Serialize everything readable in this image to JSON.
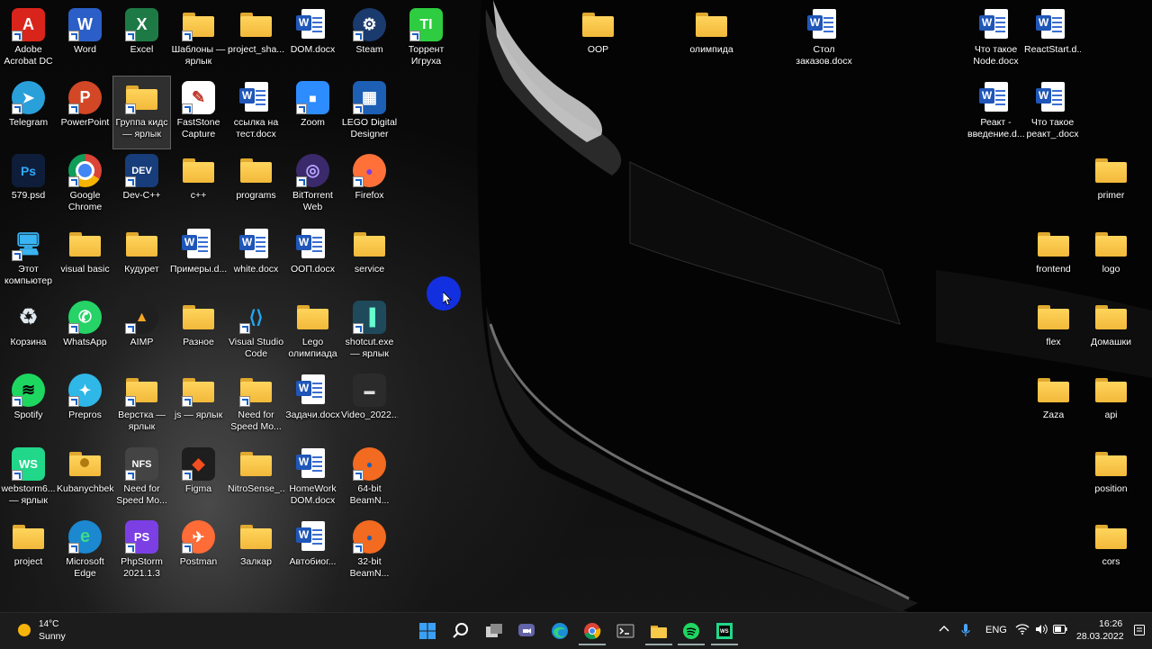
{
  "desktop": {
    "left_icons": [
      {
        "label": "Adobe Acrobat DC",
        "icon": "acrobat-icon"
      },
      {
        "label": "Word",
        "icon": "word-icon"
      },
      {
        "label": "Excel",
        "icon": "excel-icon"
      },
      {
        "label": "Шаблоны — ярлык",
        "icon": "folder-icon"
      },
      {
        "label": "project_sha...",
        "icon": "folder-icon"
      },
      {
        "label": "DOM.docx",
        "icon": "word-doc-icon"
      },
      {
        "label": "Steam",
        "icon": "steam-icon"
      },
      {
        "label": "Торрент Игруха",
        "icon": "torrent-igruha-icon"
      },
      {
        "label": "Telegram",
        "icon": "telegram-icon"
      },
      {
        "label": "PowerPoint",
        "icon": "powerpoint-icon"
      },
      {
        "label": "Группа кидс — ярлык",
        "icon": "folder-icon"
      },
      {
        "label": "FastStone Capture",
        "icon": "faststone-icon"
      },
      {
        "label": "ссылка на тест.docx",
        "icon": "word-doc-icon"
      },
      {
        "label": "Zoom",
        "icon": "zoom-icon"
      },
      {
        "label": "LEGO Digital Designer",
        "icon": "lego-icon"
      },
      {
        "label": "579.psd",
        "icon": "psd-icon"
      },
      {
        "label": "Google Chrome",
        "icon": "chrome-icon"
      },
      {
        "label": "Dev-C++",
        "icon": "devcpp-icon"
      },
      {
        "label": "c++",
        "icon": "folder-icon"
      },
      {
        "label": "programs",
        "icon": "folder-icon"
      },
      {
        "label": "BitTorrent Web",
        "icon": "bittorrent-icon"
      },
      {
        "label": "Firefox",
        "icon": "firefox-icon"
      },
      {
        "label": "Этот компьютер",
        "icon": "computer-icon"
      },
      {
        "label": "visual basic",
        "icon": "folder-icon"
      },
      {
        "label": "Кудурет",
        "icon": "folder-icon"
      },
      {
        "label": "Примеры.d...",
        "icon": "word-doc-icon"
      },
      {
        "label": "white.docx",
        "icon": "word-doc-icon"
      },
      {
        "label": "ООП.docx",
        "icon": "word-doc-icon"
      },
      {
        "label": "service",
        "icon": "folder-icon"
      },
      {
        "label": "Корзина",
        "icon": "recycle-bin-icon"
      },
      {
        "label": "WhatsApp",
        "icon": "whatsapp-icon"
      },
      {
        "label": "AIMP",
        "icon": "aimp-icon"
      },
      {
        "label": "Разное",
        "icon": "folder-icon"
      },
      {
        "label": "Visual Studio Code",
        "icon": "vscode-icon"
      },
      {
        "label": "Lego олимпиада",
        "icon": "folder-icon"
      },
      {
        "label": "shotcut.exe — ярлык",
        "icon": "shotcut-icon"
      },
      {
        "label": "Spotify",
        "icon": "spotify-icon"
      },
      {
        "label": "Prepros",
        "icon": "prepros-icon"
      },
      {
        "label": "Верстка — ярлык",
        "icon": "folder-icon"
      },
      {
        "label": "js — ярлык",
        "icon": "folder-icon"
      },
      {
        "label": "Need for Speed Mo...",
        "icon": "folder-icon"
      },
      {
        "label": "Задачи.docx",
        "icon": "word-doc-icon"
      },
      {
        "label": "Video_2022...",
        "icon": "video-file-icon"
      },
      {
        "label": "webstorm6... — ярлык",
        "icon": "webstorm-icon"
      },
      {
        "label": "Kubanychbek",
        "icon": "user-folder-icon"
      },
      {
        "label": "Need for Speed Mo...",
        "icon": "nfs-icon"
      },
      {
        "label": "Figma",
        "icon": "figma-icon"
      },
      {
        "label": "NitroSense_...",
        "icon": "folder-icon"
      },
      {
        "label": "HomeWork DOM.docx",
        "icon": "word-doc-icon"
      },
      {
        "label": "64-bit BeamN...",
        "icon": "beamng-icon"
      },
      {
        "label": "project",
        "icon": "folder-icon"
      },
      {
        "label": "Microsoft Edge",
        "icon": "edge-icon"
      },
      {
        "label": "PhpStorm 2021.1.3",
        "icon": "phpstorm-icon"
      },
      {
        "label": "Postman",
        "icon": "postman-icon"
      },
      {
        "label": "Залкар",
        "icon": "folder-icon"
      },
      {
        "label": "Автобиог...",
        "icon": "word-doc-icon"
      },
      {
        "label": "32-bit BeamN...",
        "icon": "beamng-icon"
      }
    ],
    "right_icons": [
      {
        "label": "ООР",
        "icon": "folder-icon"
      },
      {
        "label": "олимпида",
        "icon": "folder-icon"
      },
      {
        "label": "Стол заказов.docx",
        "icon": "word-doc-icon"
      },
      {
        "label": "Что такое Node.docx",
        "icon": "word-doc-icon"
      },
      {
        "label": "ReactStart.d...",
        "icon": "word-doc-icon"
      },
      {
        "label": "Реакт - введение.d...",
        "icon": "word-doc-icon"
      },
      {
        "label": "Что такое реакт_.docx",
        "icon": "word-doc-icon"
      },
      {
        "label": "primer",
        "icon": "folder-icon"
      },
      {
        "label": "frontend",
        "icon": "folder-icon"
      },
      {
        "label": "logo",
        "icon": "folder-icon"
      },
      {
        "label": "flex",
        "icon": "folder-icon"
      },
      {
        "label": "Домашки",
        "icon": "folder-icon"
      },
      {
        "label": "Zaza",
        "icon": "folder-icon"
      },
      {
        "label": "api",
        "icon": "folder-icon"
      },
      {
        "label": "position",
        "icon": "folder-icon"
      },
      {
        "label": "cors",
        "icon": "folder-icon"
      }
    ],
    "selected_label": "Группа кидс — ярлык"
  },
  "taskbar": {
    "weather": {
      "temp": "14°C",
      "condition": "Sunny",
      "icon": "sun-icon"
    },
    "pinned": [
      "start-icon",
      "search-icon",
      "task-view-icon",
      "teams-chat-icon",
      "edge-icon",
      "chrome-icon",
      "terminal-icon",
      "file-explorer-icon",
      "spotify-icon",
      "webstorm-icon"
    ],
    "tray": {
      "language": "ENG",
      "time": "16:26",
      "date": "28.03.2022",
      "icons": [
        "chevron-up-icon",
        "microphone-icon",
        "wifi-icon",
        "volume-icon",
        "battery-icon",
        "notification-icon"
      ]
    }
  },
  "colors": {
    "taskbar_bg": "#1c1c1c",
    "folder": "#f5bd3f",
    "word_blue": "#1f56b8",
    "highlight": "#1230e0"
  }
}
